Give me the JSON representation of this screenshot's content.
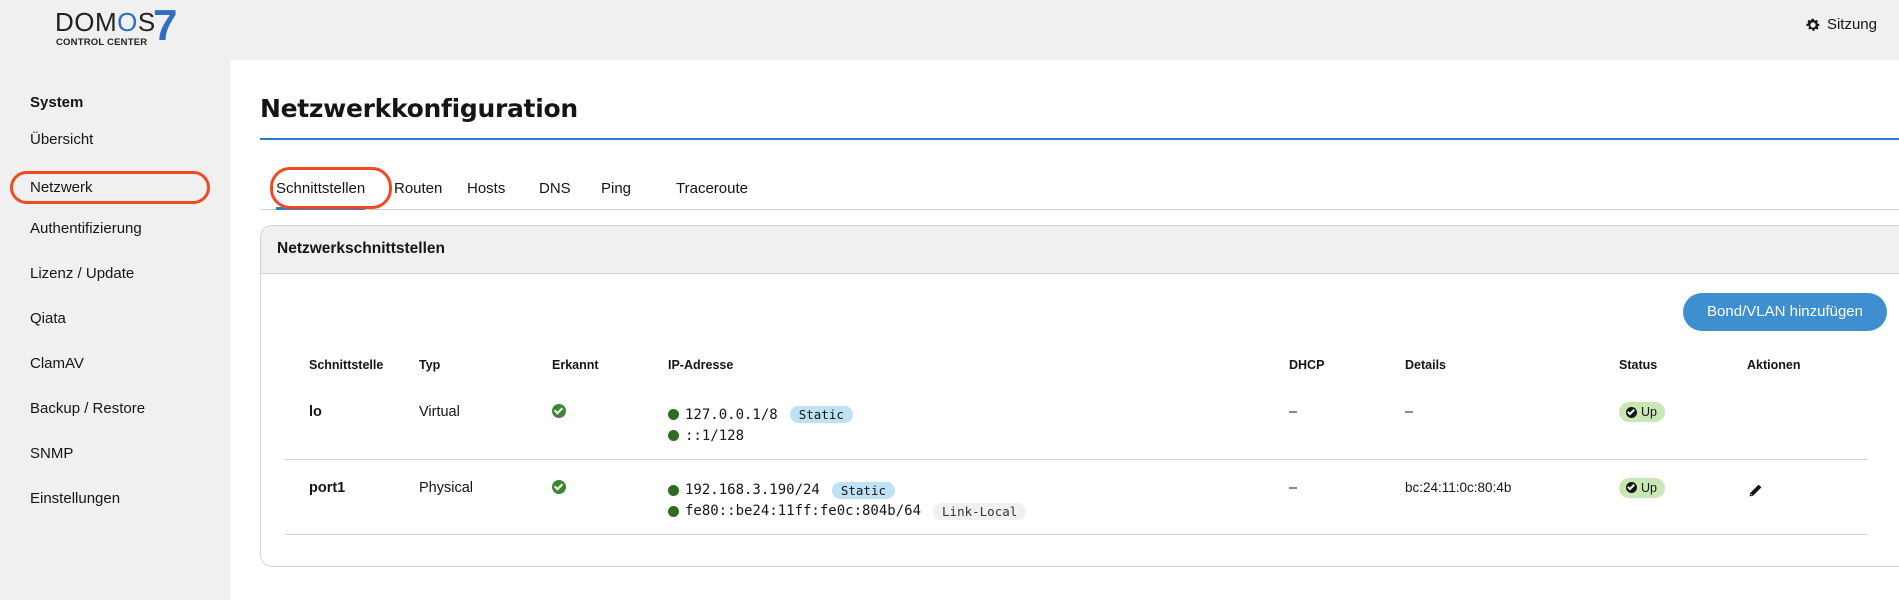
{
  "header": {
    "logo_word_prefix": "DOM",
    "logo_word_o": "O",
    "logo_word_suffix": "S",
    "logo_number": "7",
    "logo_subtitle": "CONTROL CENTER",
    "session_label": "Sitzung",
    "session_icon": "gear-icon"
  },
  "sidebar": {
    "section_title": "System",
    "items": [
      {
        "label": "Übersicht"
      },
      {
        "label": "Netzwerk"
      },
      {
        "label": "Authentifizierung"
      },
      {
        "label": "Lizenz / Update"
      },
      {
        "label": "Qiata"
      },
      {
        "label": "ClamAV"
      },
      {
        "label": "Backup / Restore"
      },
      {
        "label": "SNMP"
      },
      {
        "label": "Einstellungen"
      }
    ],
    "active": "Netzwerk"
  },
  "main": {
    "title": "Netzwerkkonfiguration",
    "tabs": [
      {
        "label": "Schnittstellen"
      },
      {
        "label": "Routen"
      },
      {
        "label": "Hosts"
      },
      {
        "label": "DNS"
      },
      {
        "label": "Ping"
      },
      {
        "label": "Traceroute"
      }
    ],
    "selected_tab": "Schnittstellen",
    "panel": {
      "title": "Netzwerkschnittstellen",
      "add_button": "Bond/VLAN hinzufügen",
      "columns": [
        "Schnittstelle",
        "Typ",
        "Erkannt",
        "IP-Adresse",
        "DHCP",
        "Details",
        "Status",
        "Aktionen"
      ],
      "rows": [
        {
          "name": "lo",
          "type": "Virtual",
          "detected": true,
          "ips": [
            {
              "address": "127.0.0.1/8",
              "tag": "Static"
            },
            {
              "address": "::1/128",
              "tag": ""
            }
          ],
          "dhcp": "–",
          "details": "–",
          "status": "Up"
        },
        {
          "name": "port1",
          "type": "Physical",
          "detected": true,
          "ips": [
            {
              "address": "192.168.3.190/24",
              "tag": "Static"
            },
            {
              "address": "fe80::be24:11ff:fe0c:804b/64",
              "tag": "Link-Local"
            }
          ],
          "dhcp": "–",
          "details": "bc:24:11:0c:80:4b",
          "status": "Up"
        }
      ]
    }
  },
  "colors": {
    "accent": "#2b7dc7",
    "button": "#3d8fcf",
    "highlight_ring": "#f04a23",
    "status_up_bg": "#c9e7b4",
    "static_tag_bg": "#bee1f4"
  }
}
